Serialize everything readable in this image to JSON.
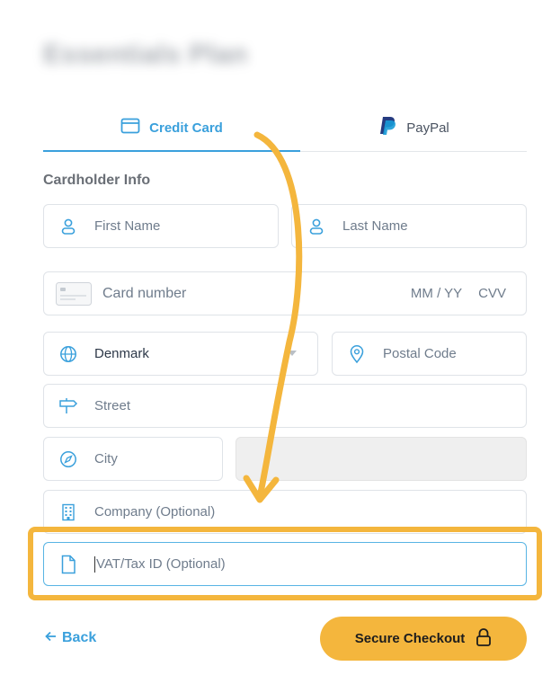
{
  "plan": {
    "title": "Essentials Plan"
  },
  "tabs": [
    {
      "label": "Credit Card",
      "active": true,
      "icon": "credit-card-icon"
    },
    {
      "label": "PayPal",
      "active": false,
      "icon": "paypal-logo-icon"
    }
  ],
  "cardholder": {
    "heading": "Cardholder Info",
    "first_name": {
      "placeholder": "First Name",
      "icon": "user-icon"
    },
    "last_name": {
      "placeholder": "Last Name",
      "icon": "user-icon"
    },
    "card_number": {
      "placeholder": "Card number",
      "expiry_placeholder": "MM / YY",
      "cvv_placeholder": "CVV",
      "icon": "card-icon"
    },
    "country": {
      "value": "Denmark",
      "icon": "globe-icon"
    },
    "postal_code": {
      "placeholder": "Postal Code",
      "icon": "location-pin-icon"
    },
    "street": {
      "placeholder": "Street",
      "icon": "signpost-icon"
    },
    "city": {
      "placeholder": "City",
      "icon": "compass-icon"
    },
    "company": {
      "placeholder": "Company (Optional)",
      "icon": "building-icon"
    },
    "vat": {
      "placeholder": "VAT/Tax ID (Optional)",
      "icon": "document-icon"
    }
  },
  "footer": {
    "back_label": "Back",
    "checkout_label": "Secure Checkout"
  },
  "colors": {
    "accent": "#3aa0dc",
    "highlight": "#f4b63d",
    "checkout_button": "#f4b63d"
  }
}
